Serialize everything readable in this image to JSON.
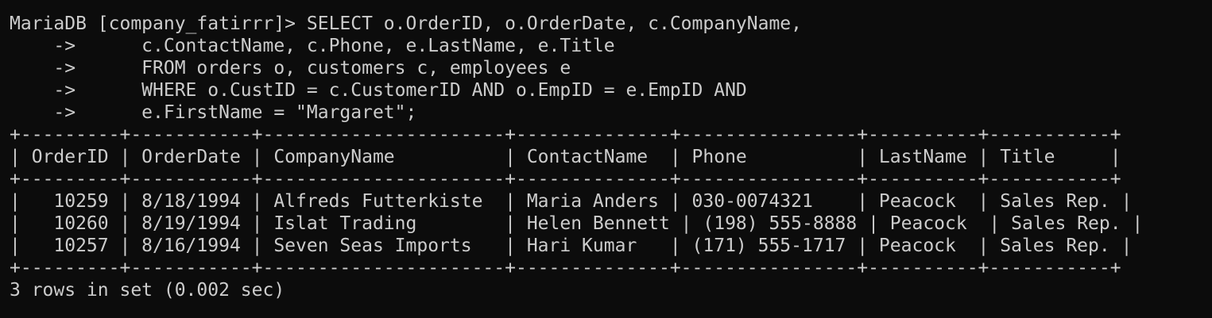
{
  "terminal": {
    "prompt": "MariaDB [company_fatirrr]> ",
    "continuation_prompt": "    ->      ",
    "query_lines": [
      "SELECT o.OrderID, o.OrderDate, c.CompanyName,",
      "c.ContactName, c.Phone, e.LastName, e.Title",
      "FROM orders o, customers c, employees e",
      "WHERE o.CustID = c.CustomerID AND o.EmpID = e.EmpID AND",
      "e.FirstName = \"Margaret\";"
    ],
    "result": {
      "border": "+---------+-----------+----------------------+--------------+----------------+----------+-----------+",
      "header": "| OrderID | OrderDate | CompanyName          | ContactName  | Phone          | LastName | Title     |",
      "columns": [
        "OrderID",
        "OrderDate",
        "CompanyName",
        "ContactName",
        "Phone",
        "LastName",
        "Title"
      ],
      "rows_text": [
        "|   10259 | 8/18/1994 | Alfreds Futterkiste  | Maria Anders | 030-0074321    | Peacock  | Sales Rep. |",
        "|   10260 | 8/19/1994 | Islat Trading        | Helen Bennett | (198) 555-8888 | Peacock  | Sales Rep. |",
        "|   10257 | 8/16/1994 | Seven Seas Imports   | Hari Kumar   | (171) 555-1717 | Peacock  | Sales Rep. |"
      ],
      "rows": [
        [
          "10259",
          "8/18/1994",
          "Alfreds Futterkiste",
          "Maria Anders",
          "030-0074321",
          "Peacock",
          "Sales Rep."
        ],
        [
          "10260",
          "8/19/1994",
          "Islat Trading",
          "Helen Bennett",
          "(198) 555-8888",
          "Peacock",
          "Sales Rep."
        ],
        [
          "10257",
          "8/16/1994",
          "Seven Seas Imports",
          "Hari Kumar",
          "(171) 555-1717",
          "Peacock",
          "Sales Rep."
        ]
      ]
    },
    "footer": "3 rows in set (0.002 sec)",
    "colors": {
      "background": "#0c0c0c",
      "text": "#cccccc"
    }
  }
}
